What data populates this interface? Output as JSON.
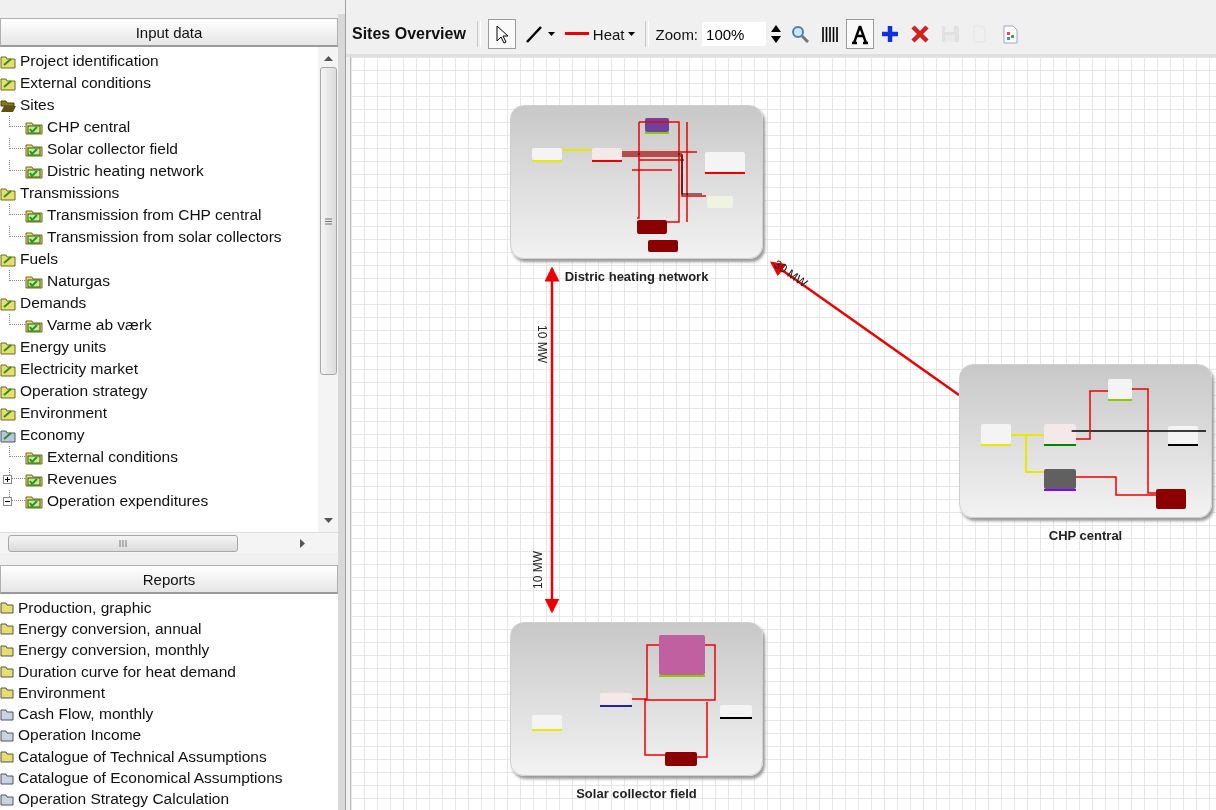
{
  "input_panel": {
    "title": "Input data",
    "items": [
      {
        "label": "Project identification",
        "kind": "folder"
      },
      {
        "label": "External conditions",
        "kind": "folder"
      },
      {
        "label": "Sites",
        "kind": "folder-open",
        "children": [
          {
            "label": "CHP central"
          },
          {
            "label": "Solar collector field"
          },
          {
            "label": "Distric heating network"
          }
        ]
      },
      {
        "label": "Transmissions",
        "kind": "folder",
        "children": [
          {
            "label": "Transmission from CHP central"
          },
          {
            "label": "Transmission from solar collectors"
          }
        ]
      },
      {
        "label": "Fuels",
        "kind": "folder",
        "children": [
          {
            "label": "Naturgas"
          }
        ]
      },
      {
        "label": "Demands",
        "kind": "folder",
        "children": [
          {
            "label": "Varme ab værk"
          }
        ]
      },
      {
        "label": "Energy units",
        "kind": "folder"
      },
      {
        "label": "Electricity market",
        "kind": "folder"
      },
      {
        "label": "Operation strategy",
        "kind": "folder"
      },
      {
        "label": "Environment",
        "kind": "folder"
      },
      {
        "label": "Economy",
        "kind": "folder-blue",
        "children": [
          {
            "label": "External conditions"
          },
          {
            "label": "Revenues",
            "expanded": false
          },
          {
            "label": "Operation expenditures",
            "expanded": true
          }
        ]
      }
    ]
  },
  "reports_panel": {
    "title": "Reports",
    "items": [
      {
        "label": "Production, graphic",
        "color": "#e6df6e"
      },
      {
        "label": "Energy conversion, annual",
        "color": "#e6df6e"
      },
      {
        "label": "Energy conversion, monthly",
        "color": "#e6df6e"
      },
      {
        "label": "Duration curve for heat demand",
        "color": "#e6df6e"
      },
      {
        "label": "Environment",
        "color": "#e6df6e"
      },
      {
        "label": "Cash Flow, monthly",
        "color": "#c5d3e3"
      },
      {
        "label": "Operation Income",
        "color": "#c5d3e3"
      },
      {
        "label": "Catalogue of Technical Assumptions",
        "color": "#e6df6e"
      },
      {
        "label": "Catalogue of Economical Assumptions",
        "color": "#c5d3e3"
      },
      {
        "label": "Operation Strategy Calculation",
        "color": "#c5d3e3"
      }
    ]
  },
  "toolbar": {
    "title": "Sites Overview",
    "tools": [
      {
        "kind": "pointer",
        "selected": true,
        "disabled": false
      },
      {
        "kind": "line",
        "selected": false,
        "disabled": false
      }
    ],
    "line_type": {
      "label": "Heat"
    },
    "zoom": {
      "label": "Zoom:",
      "value": "100%"
    },
    "buttons": [
      {
        "kind": "magnifier",
        "selected": false,
        "disabled": false
      },
      {
        "kind": "grid",
        "selected": false,
        "disabled": false
      },
      {
        "kind": "text",
        "selected": true,
        "disabled": false
      },
      {
        "kind": "add",
        "selected": false,
        "disabled": false
      },
      {
        "kind": "delete",
        "selected": false,
        "disabled": false
      },
      {
        "kind": "save",
        "selected": false,
        "disabled": true
      },
      {
        "kind": "copy",
        "selected": false,
        "disabled": true
      },
      {
        "kind": "report",
        "selected": false,
        "disabled": false
      }
    ]
  },
  "canvas": {
    "sites": [
      {
        "name": "Distric heating network",
        "kind": "district"
      },
      {
        "name": "CHP central",
        "kind": "chp"
      },
      {
        "name": "Solar collector field",
        "kind": "solar"
      }
    ],
    "links": [
      {
        "kind": "single",
        "labels": [
          "30 MW"
        ]
      },
      {
        "kind": "double",
        "labels": [
          "10 MW",
          "10 MW"
        ]
      }
    ]
  }
}
